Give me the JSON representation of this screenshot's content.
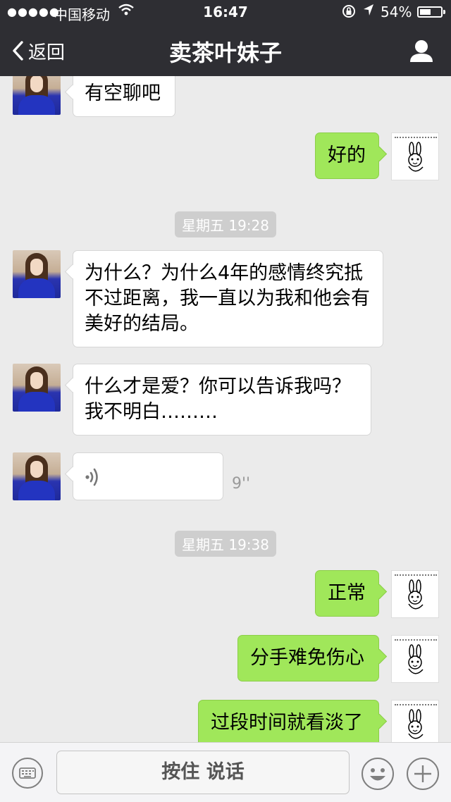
{
  "status_bar": {
    "signal": "●●●●●",
    "carrier": "中国移动",
    "time": "16:47",
    "battery": "54%",
    "battery_level": 0.54
  },
  "nav": {
    "back_label": "返回",
    "title": "卖茶叶妹子"
  },
  "messages": {
    "m1": "有空聊吧",
    "m2": "好的",
    "ts1": "星期五 19:28",
    "m3": "为什么？为什么4年的感情终究抵不过距离，我一直以为我和他会有美好的结局。",
    "m4": "什么才是爱？你可以告诉我吗？我不明白………",
    "voice_duration": "9''",
    "ts2": "星期五 19:38",
    "m5": "正常",
    "m6": "分手难免伤心",
    "m7": "过段时间就看淡了"
  },
  "input_bar": {
    "hold_to_talk": "按住 说话"
  },
  "colors": {
    "nav_bg": "#2e2e33",
    "chat_bg": "#ebebeb",
    "bubble_sent": "#a0e75a",
    "bubble_received": "#ffffff"
  },
  "icons": {
    "back": "chevron-left-icon",
    "profile": "person-icon",
    "voice": "sound-wave-icon",
    "keyboard": "keyboard-icon",
    "emoji": "emoji-icon",
    "plus": "plus-icon"
  }
}
